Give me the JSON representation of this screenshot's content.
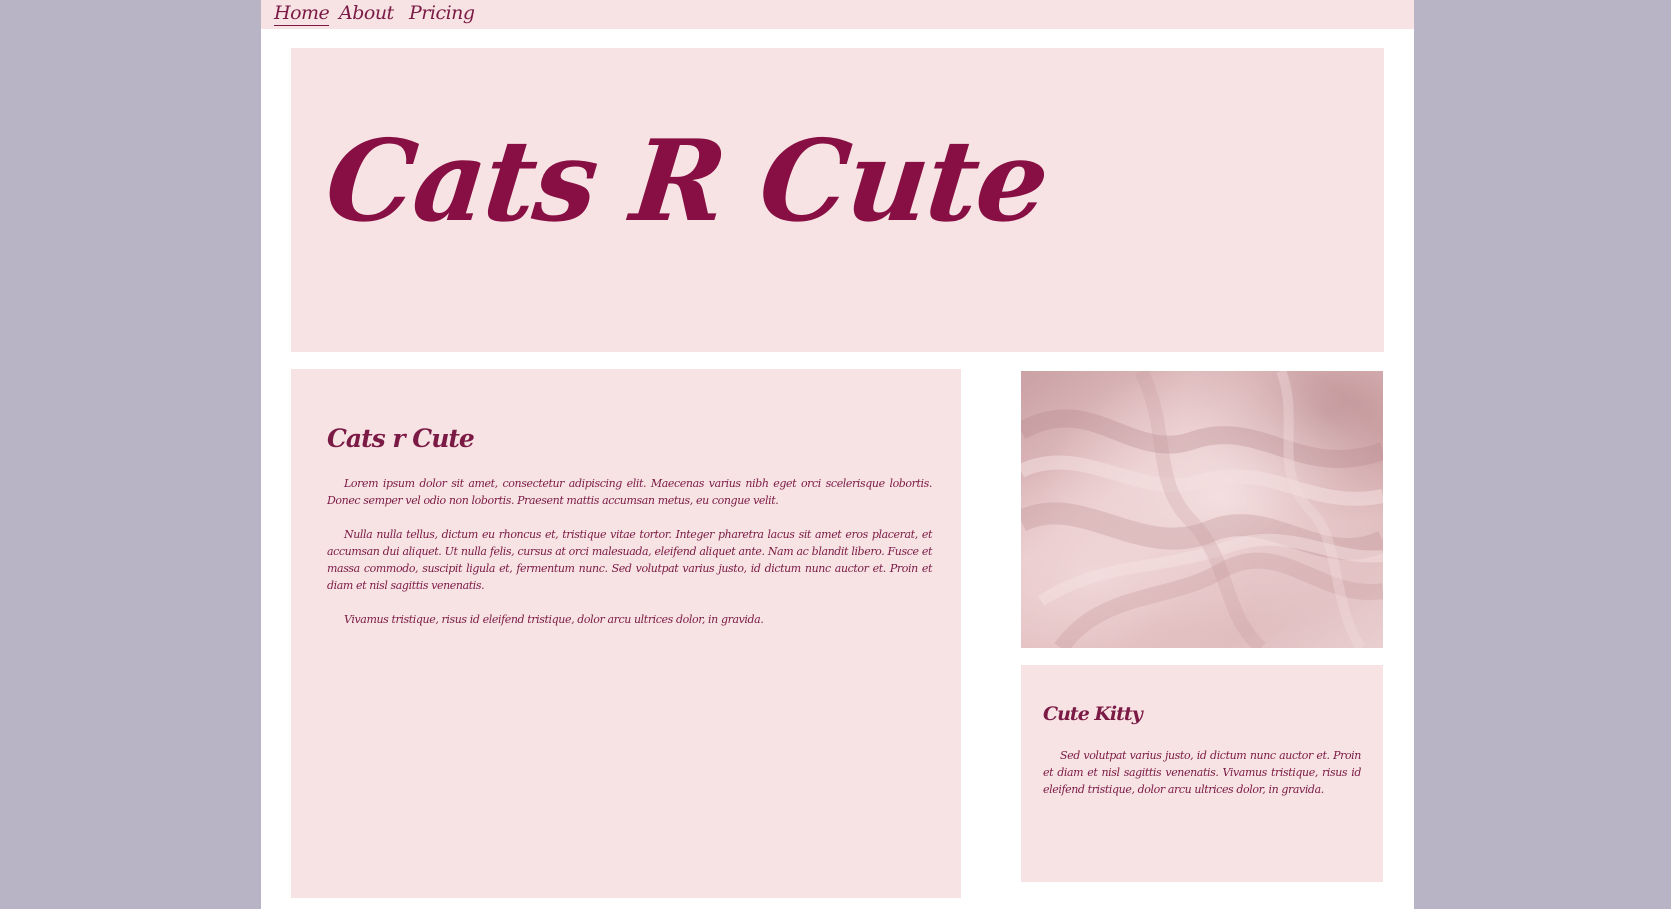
{
  "nav": {
    "items": [
      {
        "label": "Home",
        "active": true
      },
      {
        "label": "About",
        "active": false
      },
      {
        "label": "Pricing",
        "active": false
      }
    ]
  },
  "hero": {
    "title": "Cats R Cute"
  },
  "main": {
    "heading": "Cats r Cute",
    "paragraphs": [
      "Lorem ipsum dolor sit amet, consectetur adipiscing elit. Maecenas varius nibh eget orci scelerisque lobortis. Donec semper vel odio non lobortis. Praesent mattis accumsan metus, eu congue velit.",
      "Nulla nulla tellus, dictum eu rhoncus et, tristique vitae tortor. Integer pharetra lacus sit amet eros placerat, et accumsan dui aliquet. Ut nulla felis, cursus at orci malesuada, eleifend aliquet ante. Nam ac blandit libero. Fusce et massa commodo, suscipit ligula et, fermentum nunc. Sed volutpat varius justo, id dictum nunc auctor et. Proin et diam et nisl sagittis venenatis.",
      "Vivamus tristique, risus id eleifend tristique, dolor arcu ultrices dolor, in gravida."
    ]
  },
  "side_image": {
    "name": "pink-fabric-photo"
  },
  "kitty": {
    "heading": "Cute Kitty",
    "text": "Sed volutpat varius justo, id dictum nunc auctor et. Proin et diam et nisl sagittis venenatis. Vivamus tristique, risus id eleifend tristique, dolor arcu ultrices dolor, in gravida."
  },
  "colors": {
    "background": "#b9b3c6",
    "panel": "#f8e3e4",
    "text": "#7a1a45",
    "title": "#870f43"
  }
}
